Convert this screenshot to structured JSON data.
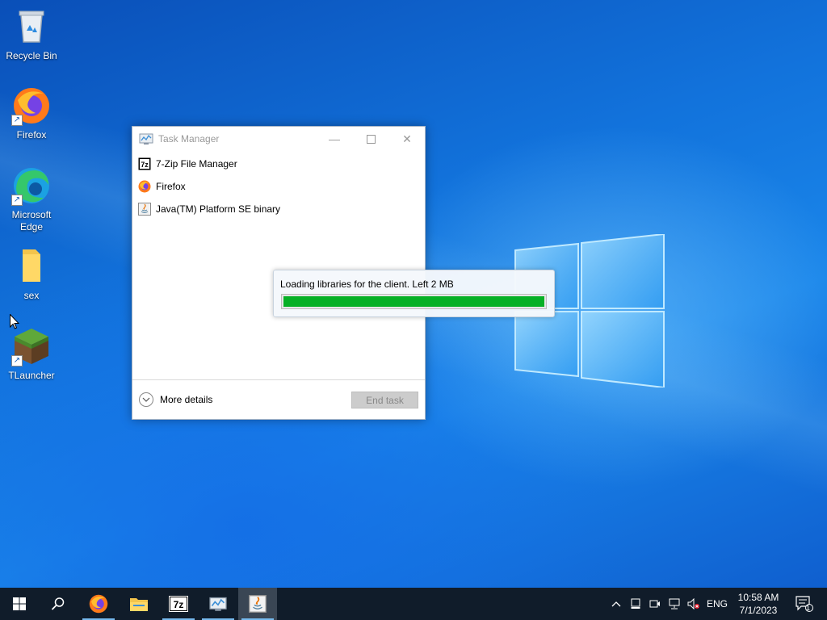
{
  "desktop": {
    "icons": [
      {
        "label": "Recycle Bin",
        "icon": "recycle-bin-icon"
      },
      {
        "label": "Firefox",
        "icon": "firefox-icon"
      },
      {
        "label": "Microsoft Edge",
        "icon": "edge-icon"
      },
      {
        "label": "sex",
        "icon": "folder-icon"
      },
      {
        "label": "TLauncher",
        "icon": "grass-block-icon"
      }
    ]
  },
  "task_manager": {
    "title": "Task Manager",
    "apps": [
      {
        "label": "7-Zip File Manager",
        "icon": "7zip-icon"
      },
      {
        "label": "Firefox",
        "icon": "firefox-icon"
      },
      {
        "label": "Java(TM) Platform SE binary",
        "icon": "java-icon"
      }
    ],
    "more_details": "More details",
    "end_task": "End task"
  },
  "loader": {
    "message": "Loading libraries for the client. Left 2 MB",
    "progress": 1.0,
    "bar_color": "#06b025"
  },
  "taskbar": {
    "pinned": [
      "start-icon",
      "search-icon",
      "firefox-icon",
      "file-explorer-icon",
      "7zip-icon",
      "task-manager-icon",
      "java-icon"
    ],
    "language": "ENG",
    "time": "10:58 AM",
    "date": "7/1/2023",
    "notification_count": "1"
  }
}
